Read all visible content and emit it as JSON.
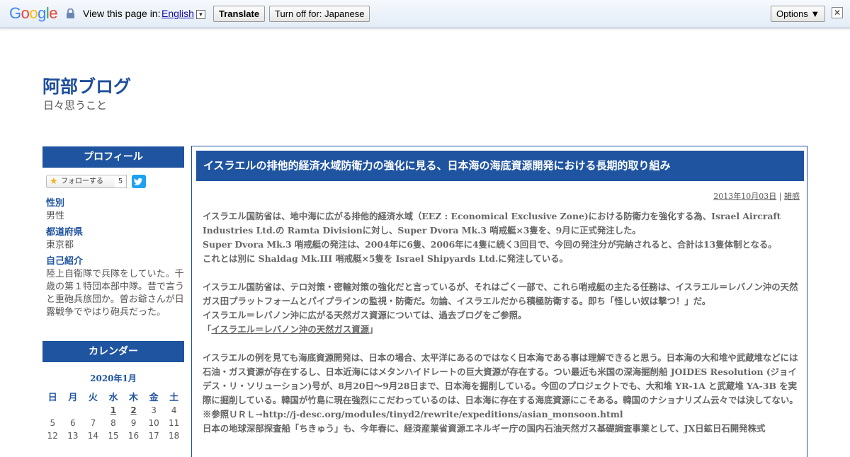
{
  "translate_bar": {
    "logo": "Google",
    "view_label": "View this page in:",
    "language": "English",
    "translate_button": "Translate",
    "turn_off_button": "Turn off for: Japanese",
    "options_button": "Options ▼",
    "close": "✕",
    "dropdown": "▼"
  },
  "blog": {
    "title": "阿部ブログ",
    "description": "日々思うこと"
  },
  "sidebar": {
    "profile_heading": "プロフィール",
    "follow_label": "フォローする",
    "follow_count": "5",
    "profile": [
      {
        "label": "性別",
        "value": "男性"
      },
      {
        "label": "都道府県",
        "value": "東京都"
      },
      {
        "label": "自己紹介",
        "value": "陸上自衛隊で兵隊をしていた。千歳の第１特団本部中隊。昔で言うと重砲兵旅団か。曽お爺さんが日露戦争でやはり砲兵だった。"
      }
    ],
    "calendar_heading": "カレンダー",
    "calendar": {
      "month": "2020年1月",
      "weekdays": [
        "日",
        "月",
        "火",
        "水",
        "木",
        "金",
        "土"
      ],
      "rows": [
        [
          "",
          "",
          "",
          "1",
          "2",
          "3",
          "4"
        ],
        [
          "5",
          "6",
          "7",
          "8",
          "9",
          "10",
          "11"
        ],
        [
          "12",
          "13",
          "14",
          "15",
          "16",
          "17",
          "18"
        ]
      ]
    }
  },
  "post": {
    "title": "イスラエルの排他的経済水域防衛力の強化に見る、日本海の海底資源開発における長期的取り組み",
    "date": "2013年10月03日",
    "separator": "|",
    "category": "雑感",
    "paragraphs": [
      "イスラエル国防省は、地中海に広がる排他的経済水域（EEZ : Economical Exclusive Zone)における防衛力を強化する為、Israel Aircraft Industries Ltd.の Ramta Divisionに対し、Super Dvora Mk.3 哨戒艇×3隻を、9月に正式発注した。",
      "Super Dvora Mk.3 哨戒艇の発注は、2004年に6隻、2006年に4隻に続く3回目で、今回の発注分が完納されると、合計は13隻体制となる。",
      "これとは別に Shaldag Mk.III 哨戒艇×5隻を Israel Shipyards Ltd.に発注している。",
      "",
      "イスラエル国防省は、テロ対策・密輸対策の強化だと言っているが、それはごく一部で、これら哨戒艇の主たる任務は、イスラエル＝レバノン沖の天然ガス田プラットフォームとパイプラインの監視・防衛だ。勿論、イスラエルだから積極防衛する。即ち「怪しい奴は撃つ！」だ。",
      "イスラエル＝レバノン沖に広がる天然ガス資源については、過去ブログをご参照。"
    ],
    "link_prefix": "「",
    "link_text": "イスラエル＝レバノン沖の天然ガス資源",
    "link_suffix": "」",
    "paragraphs2": [
      "イスラエルの例を見ても海底資源開発は、日本の場合、太平洋にあるのではなく日本海である事は理解できると思う。日本海の大和堆や武蔵堆などには石油・ガス資源が存在するし、日本近海にはメタンハイドレートの巨大資源が存在する。つい最近も米国の深海掘削船 JOIDES Resolution (ジョイデス・リ・ソリューション)号が、8月20日～9月28日まで、日本海を掘削している。今回のプロジェクトでも、大和堆 YR-1A と武蔵堆 YA-3B を実際に掘削している。韓国が竹島に現在強烈にこだわっているのは、日本海に存在する海底資源にこそある。韓国のナショナリズム云々では決してない。",
      "※参照ＵＲＬ→http://j-desc.org/modules/tinyd2/rewrite/expeditions/asian_monsoon.html",
      "日本の地球深部探査船「ちきゅう」も、今年春に、経済産業省資源エネルギー庁の国内石油天然ガス基礎調査事業として、JX日鉱日石開発株式"
    ]
  }
}
